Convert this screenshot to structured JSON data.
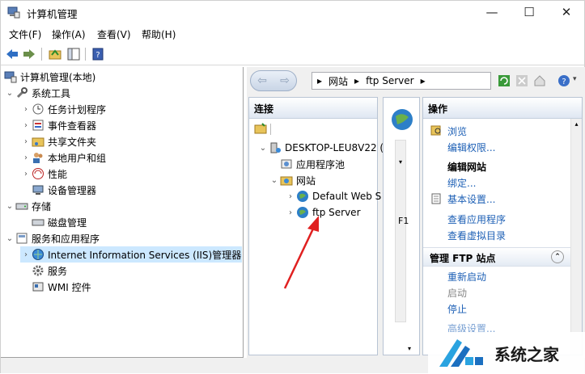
{
  "window": {
    "title": "计算机管理",
    "minimize": "—",
    "maximize": "☐",
    "close": "✕"
  },
  "menu": [
    "文件(F)",
    "操作(A)",
    "查看(V)",
    "帮助(H)"
  ],
  "tree": {
    "root": "计算机管理(本地)",
    "system_tools": "系统工具",
    "task_scheduler": "任务计划程序",
    "event_viewer": "事件查看器",
    "shared_folders": "共享文件夹",
    "local_users": "本地用户和组",
    "performance": "性能",
    "device_manager": "设备管理器",
    "storage": "存储",
    "disk_management": "磁盘管理",
    "services_apps": "服务和应用程序",
    "iis": "Internet Information Services (IIS)管理器",
    "services": "服务",
    "wmi": "WMI 控件"
  },
  "iis": {
    "address": {
      "sites": "网站",
      "current": "ftp Server"
    },
    "connections_header": "连接",
    "server": "DESKTOP-LEU8V22 (",
    "app_pools": "应用程序池",
    "sites": "网站",
    "default_site": "Default Web S",
    "ftp_site": "ftp Server",
    "mid_label": "F1"
  },
  "actions": {
    "header": "操作",
    "browse": "浏览",
    "edit_permissions": "编辑权限...",
    "edit_site_header": "编辑网站",
    "bindings": "绑定...",
    "basic_settings": "基本设置...",
    "view_apps": "查看应用程序",
    "view_vdirs": "查看虚拟目录",
    "manage_ftp_header": "管理 FTP 站点",
    "restart": "重新启动",
    "start": "启动",
    "stop": "停止",
    "advanced": "高级设置..."
  },
  "watermark": {
    "text": "系统之家"
  }
}
